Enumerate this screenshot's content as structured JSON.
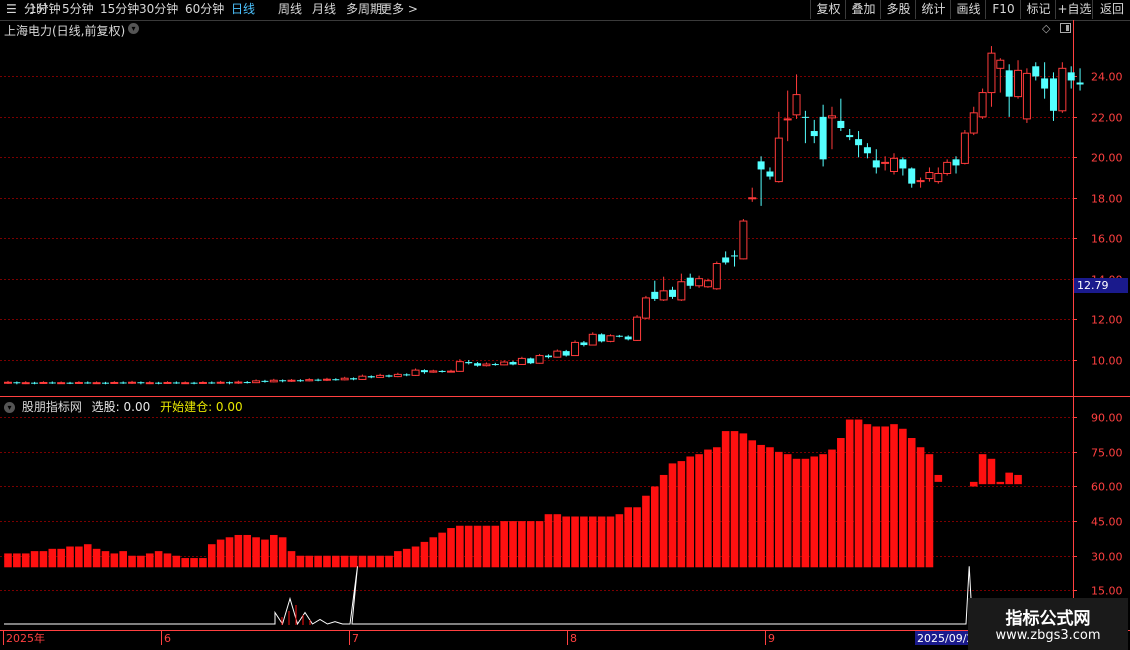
{
  "toolbar": {
    "left_items": [
      "分时",
      "1分钟",
      "5分钟",
      "15分钟",
      "30分钟",
      "60分钟",
      "日线",
      "周线",
      "月线",
      "多周期",
      "更多 >"
    ],
    "active_item": "日线",
    "right_items": [
      "复权",
      "叠加",
      "多股",
      "统计",
      "画线",
      "F10",
      "标记",
      "+自选",
      "返回"
    ]
  },
  "stock": {
    "title": "上海电力(日线,前复权)",
    "menu_icon": "chevron-down-icon"
  },
  "indicator": {
    "name": "股朋指标网",
    "select_label": "选股: 0.00",
    "build_label": "开始建仓: 0.00"
  },
  "current_price": "12.79",
  "watermark": {
    "line1": "指标公式网",
    "line2": "www.zbgs3.com"
  },
  "colors": {
    "up": "#ff3b3b",
    "down": "#54ffff",
    "grid": "#7a0000",
    "axis": "#ff4040",
    "bar": "#ff1010",
    "background": "#000000"
  },
  "chart_data": [
    {
      "type": "candlestick",
      "title": "上海电力(日线,前复权)",
      "ylim": [
        8.3,
        25.8
      ],
      "yticks": [
        10.0,
        12.0,
        14.0,
        16.0,
        18.0,
        20.0,
        22.0,
        24.0
      ],
      "x_labels": [
        {
          "i": 0,
          "label": "2025年"
        },
        {
          "i": 20,
          "label": "6"
        },
        {
          "i": 44,
          "label": "7"
        },
        {
          "i": 71,
          "label": "8"
        },
        {
          "i": 96,
          "label": "9"
        },
        {
          "i": 114,
          "label": "2025/09/2"
        }
      ],
      "candles": [
        [
          8.85,
          8.88,
          8.95,
          8.8
        ],
        [
          8.88,
          8.84,
          8.92,
          8.78
        ],
        [
          8.84,
          8.86,
          8.93,
          8.79
        ],
        [
          8.86,
          8.83,
          8.9,
          8.78
        ],
        [
          8.83,
          8.87,
          8.93,
          8.8
        ],
        [
          8.87,
          8.85,
          8.92,
          8.8
        ],
        [
          8.85,
          8.86,
          8.92,
          8.8
        ],
        [
          8.86,
          8.84,
          8.9,
          8.79
        ],
        [
          8.84,
          8.87,
          8.93,
          8.8
        ],
        [
          8.87,
          8.85,
          8.92,
          8.8
        ],
        [
          8.85,
          8.86,
          8.92,
          8.8
        ],
        [
          8.86,
          8.83,
          8.9,
          8.78
        ],
        [
          8.83,
          8.87,
          8.93,
          8.8
        ],
        [
          8.87,
          8.85,
          8.92,
          8.8
        ],
        [
          8.85,
          8.88,
          8.95,
          8.8
        ],
        [
          8.88,
          8.84,
          8.92,
          8.78
        ],
        [
          8.84,
          8.86,
          8.93,
          8.79
        ],
        [
          8.86,
          8.83,
          8.9,
          8.78
        ],
        [
          8.83,
          8.87,
          8.93,
          8.8
        ],
        [
          8.87,
          8.85,
          8.92,
          8.8
        ],
        [
          8.85,
          8.86,
          8.92,
          8.8
        ],
        [
          8.86,
          8.83,
          8.9,
          8.78
        ],
        [
          8.83,
          8.87,
          8.93,
          8.8
        ],
        [
          8.87,
          8.85,
          8.92,
          8.8
        ],
        [
          8.85,
          8.88,
          8.95,
          8.8
        ],
        [
          8.88,
          8.84,
          8.92,
          8.78
        ],
        [
          8.84,
          8.89,
          8.96,
          8.8
        ],
        [
          8.89,
          8.86,
          8.94,
          8.82
        ],
        [
          8.86,
          8.95,
          9.02,
          8.84
        ],
        [
          8.95,
          8.9,
          9.0,
          8.86
        ],
        [
          8.9,
          8.98,
          9.05,
          8.87
        ],
        [
          8.98,
          8.93,
          9.02,
          8.88
        ],
        [
          8.93,
          8.98,
          9.04,
          8.9
        ],
        [
          8.98,
          8.95,
          9.03,
          8.9
        ],
        [
          8.95,
          9.01,
          9.08,
          8.92
        ],
        [
          9.01,
          8.98,
          9.06,
          8.93
        ],
        [
          8.98,
          9.03,
          9.1,
          8.94
        ],
        [
          9.03,
          9.0,
          9.08,
          8.96
        ],
        [
          9.0,
          9.08,
          9.15,
          8.97
        ],
        [
          9.08,
          9.02,
          9.12,
          8.98
        ],
        [
          9.02,
          9.18,
          9.26,
          9.0
        ],
        [
          9.18,
          9.12,
          9.22,
          9.08
        ],
        [
          9.12,
          9.22,
          9.3,
          9.1
        ],
        [
          9.22,
          9.16,
          9.26,
          9.12
        ],
        [
          9.16,
          9.27,
          9.35,
          9.13
        ],
        [
          9.27,
          9.22,
          9.32,
          9.18
        ],
        [
          9.22,
          9.48,
          9.56,
          9.2
        ],
        [
          9.48,
          9.38,
          9.52,
          9.3
        ],
        [
          9.38,
          9.44,
          9.5,
          9.35
        ],
        [
          9.44,
          9.4,
          9.48,
          9.36
        ],
        [
          9.4,
          9.43,
          9.5,
          9.37
        ],
        [
          9.42,
          9.9,
          10.02,
          9.4
        ],
        [
          9.88,
          9.82,
          9.98,
          9.76
        ],
        [
          9.82,
          9.7,
          9.88,
          9.65
        ],
        [
          9.7,
          9.78,
          9.86,
          9.66
        ],
        [
          9.78,
          9.74,
          9.84,
          9.7
        ],
        [
          9.74,
          9.88,
          9.96,
          9.72
        ],
        [
          9.88,
          9.76,
          9.94,
          9.72
        ],
        [
          9.76,
          10.06,
          10.14,
          9.74
        ],
        [
          10.06,
          9.82,
          10.1,
          9.78
        ],
        [
          9.82,
          10.2,
          10.28,
          9.8
        ],
        [
          10.2,
          10.12,
          10.26,
          10.06
        ],
        [
          10.12,
          10.42,
          10.5,
          10.1
        ],
        [
          10.42,
          10.2,
          10.48,
          10.15
        ],
        [
          10.2,
          10.85,
          10.95,
          10.18
        ],
        [
          10.85,
          10.72,
          10.92,
          10.65
        ],
        [
          10.72,
          11.25,
          11.35,
          10.7
        ],
        [
          11.25,
          10.9,
          11.3,
          10.85
        ],
        [
          10.9,
          11.18,
          11.25,
          10.86
        ],
        [
          11.18,
          11.15,
          11.22,
          11.1
        ],
        [
          11.14,
          11.0,
          11.2,
          10.95
        ],
        [
          10.95,
          12.1,
          12.2,
          10.92
        ],
        [
          12.05,
          13.05,
          13.15,
          12.0
        ],
        [
          13.35,
          13.0,
          13.9,
          12.9
        ],
        [
          12.95,
          13.4,
          14.1,
          12.9
        ],
        [
          13.45,
          13.1,
          13.6,
          13.0
        ],
        [
          12.95,
          13.85,
          14.25,
          12.9
        ],
        [
          14.05,
          13.65,
          14.25,
          13.5
        ],
        [
          13.65,
          14.0,
          14.15,
          13.55
        ],
        [
          13.6,
          13.9,
          14.0,
          13.55
        ],
        [
          13.5,
          14.75,
          14.85,
          13.45
        ],
        [
          15.05,
          14.8,
          15.35,
          14.7
        ],
        [
          15.15,
          15.1,
          15.4,
          14.6
        ],
        [
          14.98,
          16.85,
          16.95,
          14.95
        ],
        [
          17.95,
          18.0,
          18.5,
          17.8
        ],
        [
          19.8,
          19.4,
          20.05,
          17.6
        ],
        [
          19.3,
          19.05,
          19.5,
          18.9
        ],
        [
          18.8,
          20.95,
          22.25,
          18.75
        ],
        [
          21.85,
          21.9,
          23.3,
          20.8
        ],
        [
          22.1,
          23.1,
          24.1,
          21.9
        ],
        [
          22.0,
          21.95,
          22.3,
          20.7
        ],
        [
          21.3,
          21.05,
          21.85,
          20.7
        ],
        [
          22.0,
          19.9,
          22.6,
          19.55
        ],
        [
          21.95,
          22.05,
          22.5,
          20.4
        ],
        [
          21.8,
          21.45,
          22.9,
          21.3
        ],
        [
          21.1,
          21.0,
          21.4,
          20.85
        ],
        [
          20.9,
          20.6,
          21.3,
          20.0
        ],
        [
          20.5,
          20.2,
          20.7,
          19.95
        ],
        [
          19.85,
          19.5,
          20.4,
          19.2
        ],
        [
          19.7,
          19.75,
          20.05,
          19.35
        ],
        [
          19.3,
          19.95,
          20.2,
          19.15
        ],
        [
          19.9,
          19.45,
          20.0,
          19.1
        ],
        [
          19.45,
          18.7,
          19.5,
          18.5
        ],
        [
          18.8,
          18.85,
          19.0,
          18.5
        ],
        [
          18.95,
          19.25,
          19.5,
          18.8
        ],
        [
          18.8,
          19.2,
          19.5,
          18.7
        ],
        [
          19.2,
          19.75,
          19.9,
          19.1
        ],
        [
          19.9,
          19.6,
          20.05,
          19.2
        ],
        [
          19.7,
          21.2,
          21.35,
          19.65
        ],
        [
          21.2,
          22.2,
          22.5,
          21.1
        ],
        [
          22.0,
          23.2,
          23.4,
          21.9
        ],
        [
          23.2,
          25.15,
          25.5,
          22.5
        ],
        [
          24.4,
          24.8,
          24.9,
          23.2
        ],
        [
          24.3,
          23.0,
          24.6,
          22.0
        ],
        [
          23.0,
          24.3,
          24.8,
          22.9
        ],
        [
          21.9,
          24.15,
          24.4,
          21.7
        ],
        [
          24.5,
          24.0,
          24.7,
          23.8
        ],
        [
          23.9,
          23.4,
          24.7,
          22.9
        ],
        [
          23.9,
          22.3,
          24.2,
          21.8
        ],
        [
          22.3,
          24.4,
          24.7,
          22.2
        ],
        [
          24.2,
          23.8,
          24.5,
          23.4
        ],
        [
          23.7,
          23.6,
          24.4,
          23.3
        ]
      ]
    },
    {
      "type": "bar",
      "title": "股朋指标网",
      "ylim": [
        0,
        94
      ],
      "yticks": [
        15.0,
        30.0,
        45.0,
        60.0,
        75.0,
        90.0
      ],
      "bars": [
        [
          25,
          31
        ],
        [
          25,
          31
        ],
        [
          25,
          31
        ],
        [
          25,
          32
        ],
        [
          25,
          32
        ],
        [
          25,
          33
        ],
        [
          25,
          33
        ],
        [
          25,
          34
        ],
        [
          25,
          34
        ],
        [
          25,
          35
        ],
        [
          25,
          33
        ],
        [
          25,
          32
        ],
        [
          25,
          31
        ],
        [
          25,
          32
        ],
        [
          25,
          30
        ],
        [
          25,
          30
        ],
        [
          25,
          31
        ],
        [
          25,
          32
        ],
        [
          25,
          31
        ],
        [
          25,
          30
        ],
        [
          25,
          29
        ],
        [
          25,
          29
        ],
        [
          25,
          29
        ],
        [
          25,
          35
        ],
        [
          25,
          37
        ],
        [
          25,
          38
        ],
        [
          25,
          39
        ],
        [
          25,
          39
        ],
        [
          25,
          38
        ],
        [
          25,
          37
        ],
        [
          25,
          39
        ],
        [
          25,
          38
        ],
        [
          25,
          32
        ],
        [
          25,
          30
        ],
        [
          25,
          30
        ],
        [
          25,
          30
        ],
        [
          25,
          30
        ],
        [
          25,
          30
        ],
        [
          25,
          30
        ],
        [
          25,
          30
        ],
        [
          25,
          30
        ],
        [
          25,
          30
        ],
        [
          25,
          30
        ],
        [
          25,
          30
        ],
        [
          25,
          32
        ],
        [
          25,
          33
        ],
        [
          25,
          34
        ],
        [
          25,
          36
        ],
        [
          25,
          38
        ],
        [
          25,
          40
        ],
        [
          25,
          42
        ],
        [
          25,
          43
        ],
        [
          25,
          43
        ],
        [
          25,
          43
        ],
        [
          25,
          43
        ],
        [
          25,
          43
        ],
        [
          25,
          45
        ],
        [
          25,
          45
        ],
        [
          25,
          45
        ],
        [
          25,
          45
        ],
        [
          25,
          45
        ],
        [
          25,
          48
        ],
        [
          25,
          48
        ],
        [
          25,
          47
        ],
        [
          25,
          47
        ],
        [
          25,
          47
        ],
        [
          25,
          47
        ],
        [
          25,
          47
        ],
        [
          25,
          47
        ],
        [
          25,
          48
        ],
        [
          25,
          51
        ],
        [
          25,
          51
        ],
        [
          25,
          56
        ],
        [
          25,
          60
        ],
        [
          25,
          65
        ],
        [
          25,
          70
        ],
        [
          25,
          71
        ],
        [
          25,
          73
        ],
        [
          25,
          74
        ],
        [
          25,
          76
        ],
        [
          25,
          77
        ],
        [
          25,
          84
        ],
        [
          25,
          84
        ],
        [
          25,
          83
        ],
        [
          25,
          80
        ],
        [
          25,
          78
        ],
        [
          25,
          77
        ],
        [
          25,
          75
        ],
        [
          25,
          74
        ],
        [
          25,
          72
        ],
        [
          25,
          72
        ],
        [
          25,
          73
        ],
        [
          25,
          74
        ],
        [
          25,
          76
        ],
        [
          25,
          81
        ],
        [
          25,
          89
        ],
        [
          25,
          89
        ],
        [
          25,
          87
        ],
        [
          25,
          86
        ],
        [
          25,
          86
        ],
        [
          25,
          87
        ],
        [
          25,
          85
        ],
        [
          25,
          81
        ],
        [
          25,
          77
        ],
        [
          25,
          74
        ],
        [
          62,
          65
        ]
      ],
      "bars_late_start": 116,
      "bars_late": [
        [
          60,
          62
        ],
        [
          61,
          74
        ],
        [
          61,
          72
        ],
        [
          61,
          62
        ],
        [
          61,
          66
        ],
        [
          61,
          65
        ]
      ],
      "lower_line": [
        [
          0,
          0
        ],
        [
          40,
          0
        ],
        [
          40,
          5
        ],
        [
          41,
          0
        ],
        [
          42,
          11
        ],
        [
          43,
          0
        ],
        [
          44,
          5
        ],
        [
          45,
          0
        ],
        [
          46,
          2
        ],
        [
          47,
          0
        ],
        [
          48,
          1
        ],
        [
          49,
          0
        ],
        [
          50,
          0
        ],
        [
          51,
          25
        ],
        [
          52,
          0
        ],
        [
          60,
          0
        ],
        [
          140,
          0
        ],
        [
          141,
          25
        ],
        [
          142,
          0
        ],
        [
          146,
          0
        ]
      ]
    }
  ]
}
